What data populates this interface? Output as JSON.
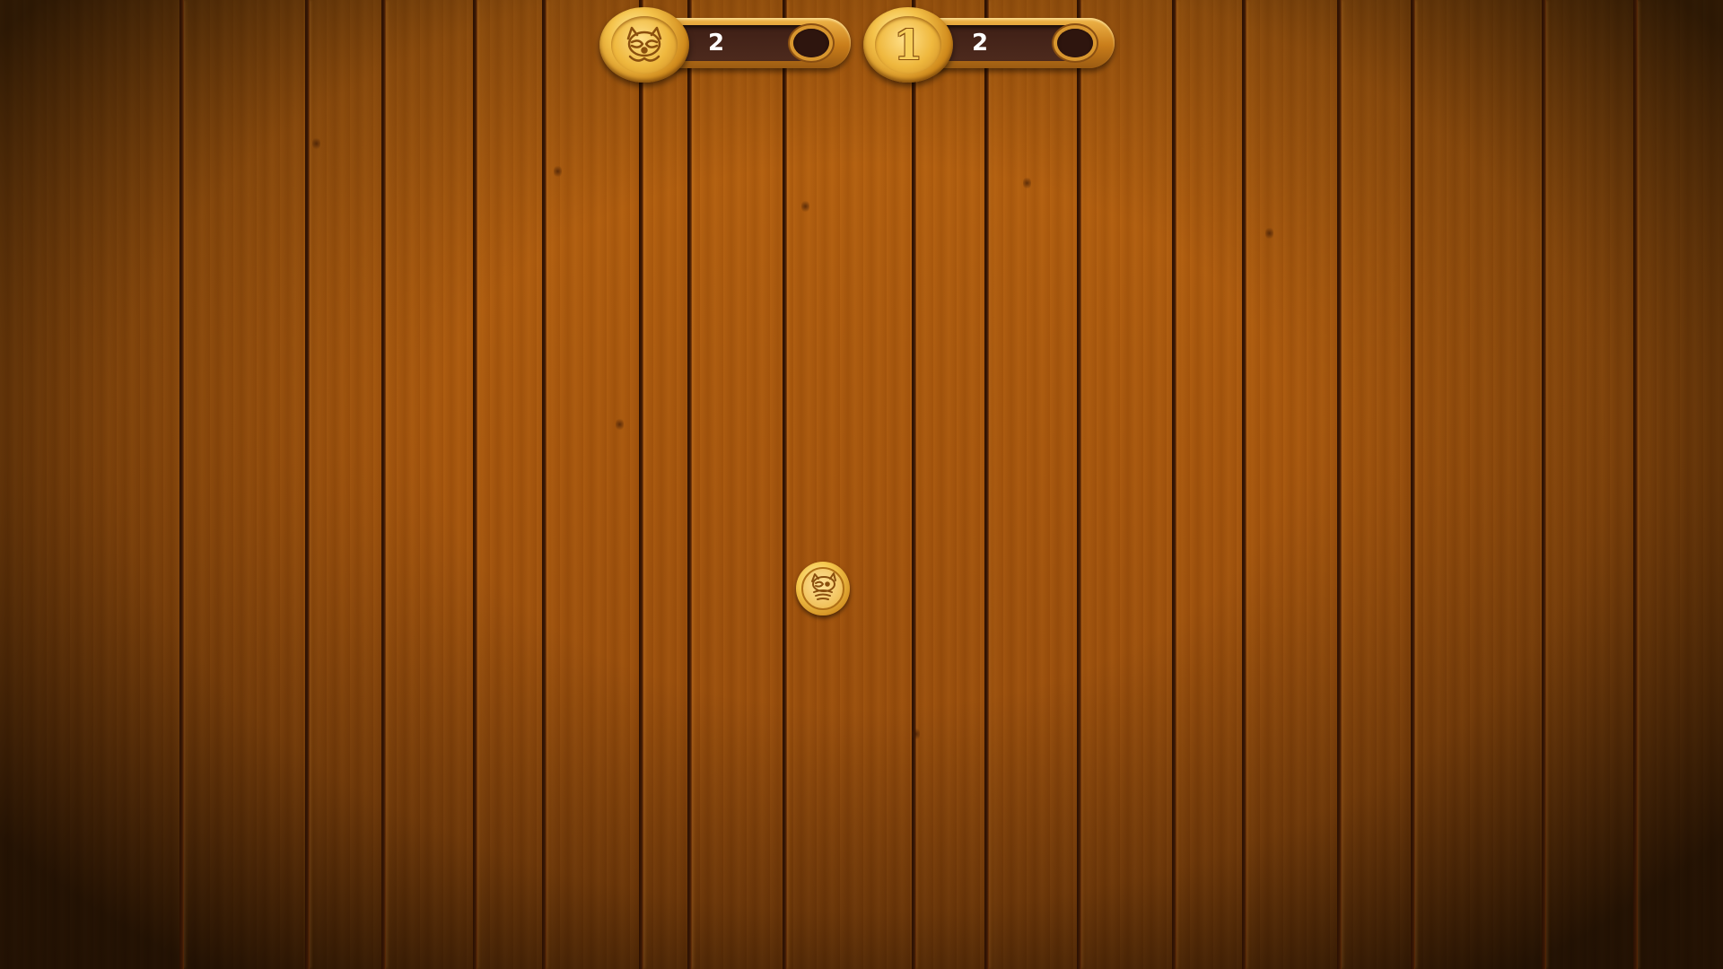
{
  "hud": {
    "raccoon_counter": {
      "value": "2",
      "icon": "raccoon-coin-icon"
    },
    "coin_counter": {
      "value": "2",
      "icon": "one-coin-icon",
      "glyph": "1"
    }
  },
  "table_coin": {
    "icon": "raccoon-coin-icon"
  },
  "colors": {
    "wood": "#a5540c",
    "gold": "#f4c24a",
    "counter_bg": "#4d2a1d",
    "counter_text": "#ffffff"
  }
}
